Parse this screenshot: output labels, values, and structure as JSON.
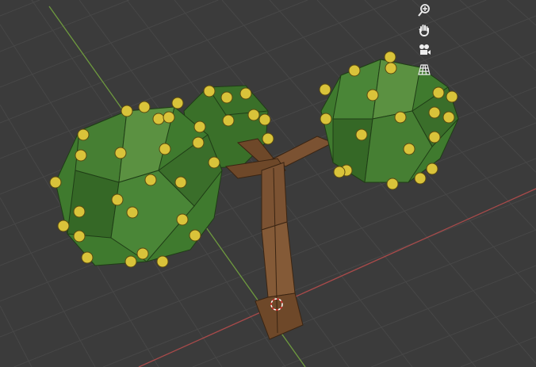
{
  "viewport": {
    "background": "#3b3b3b",
    "grid_color": "#474747",
    "x_axis_color": "#a84a4a",
    "y_axis_color": "#6e9a3e"
  },
  "model": {
    "foliage_color": "#3f7a2e",
    "foliage_edge_color": "#1f3d16",
    "fruit_color": "#d9c33a",
    "trunk_color": "#7b5232"
  },
  "navigation_gizmo": {
    "icons": [
      "zoom-icon",
      "hand-pan-icon",
      "camera-icon",
      "grid-perspective-icon"
    ]
  }
}
